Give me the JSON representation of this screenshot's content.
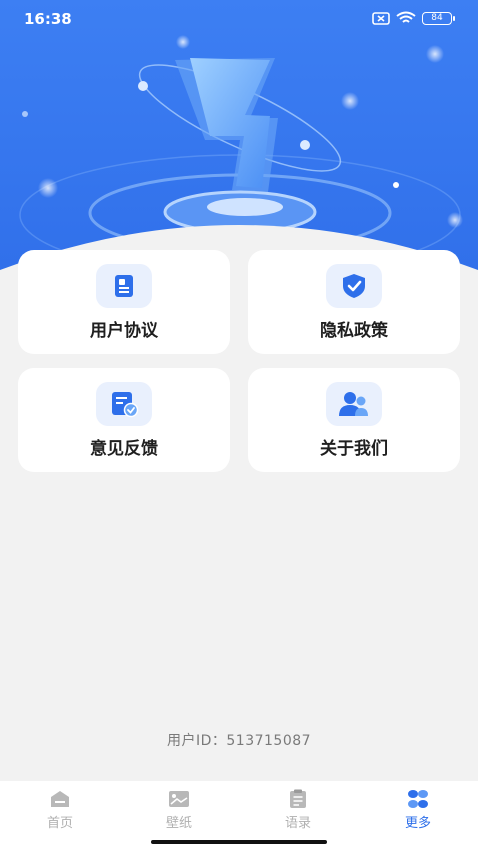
{
  "status_bar": {
    "time": "16:38",
    "battery": "84"
  },
  "colors": {
    "accent": "#2e6fea",
    "hero_blue": "#3a7bf2",
    "card_icon_bg": "#e9f0fd"
  },
  "cards": [
    {
      "label": "用户协议",
      "icon": "document-icon"
    },
    {
      "label": "隐私政策",
      "icon": "shield-check-icon"
    },
    {
      "label": "意见反馈",
      "icon": "feedback-icon"
    },
    {
      "label": "关于我们",
      "icon": "people-icon"
    }
  ],
  "user_id": {
    "label": "用户ID：",
    "value": "513715087"
  },
  "tabs": [
    {
      "label": "首页",
      "icon": "home-icon",
      "active": false
    },
    {
      "label": "壁纸",
      "icon": "wallpaper-icon",
      "active": false
    },
    {
      "label": "语录",
      "icon": "quotes-icon",
      "active": false
    },
    {
      "label": "更多",
      "icon": "more-icon",
      "active": true
    }
  ]
}
